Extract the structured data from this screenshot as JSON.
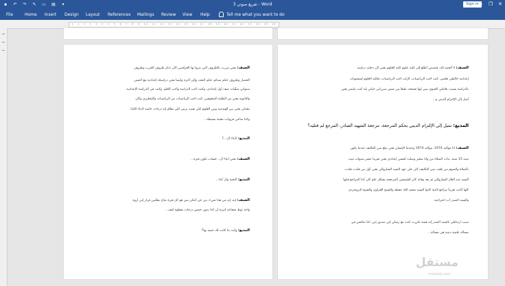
{
  "app": {
    "title": "تفريغ صوتي 3 - Word",
    "signin_label": "Sign in",
    "window_buttons": [
      "—",
      "❐",
      "✕"
    ]
  },
  "ribbon": {
    "tabs": [
      "File",
      "Home",
      "Insert",
      "Design",
      "Layout",
      "References",
      "Mailings",
      "Review",
      "View",
      "Help"
    ],
    "tell_me": "Tell me what you want to do"
  },
  "ruler": {
    "ticks": "· 2 · 1 · ▾ · 1 · 2 · 3 · 4 · 5 · 6 · 7 · 8 · 9 · 10 · 11 · 12 · 13 · 14 · 15 · 16 · 17 · 18 · 19 · 20 · 21 · 22 · 23 · 24 · 25 · 26 · 27 · 28 · 29 · 30 · 31"
  },
  "left_page": {
    "lines": [
      {
        "label": "الضيف:",
        "text": " يعني مررت بالظروف التي مروا بها العراقيين الأن تذكر ظروف الحرب وظروف"
      },
      {
        "label": "",
        "text": "الحصار وظروف حكم صدام، حكم البعث وإلى آخره وأيضاً يعني دراستك إعدادية مع أحسن"
      },
      {
        "label": "",
        "text": "سنواتي صفّيات صف أول إعدادي، وكنت أحب الدراسة وأحب العلم، وكنت في الدراسة الإعدادية"
      },
      {
        "label": "",
        "text": "والثانوية يعني من الطلبة المتفوقين، كنت أحب الرياضيات من الرياضيات والإنجليزي وكان"
      },
      {
        "label": "",
        "text": "معدلي يعني بين الهندسة وبين العلوم لكن بقيت بزمن لكن نظام إنه درجات خاصة لأبناء الكذا"
      },
      {
        "label": "",
        "text": "وكذا ساعي فرويات معينة بسيطة..."
      },
      {
        "label": "المذيع:",
        "text": " لأبناء ال...؟"
      },
      {
        "label": "الضيف:",
        "text": " يعني أبناء ال...حساب تكون فترة..."
      },
      {
        "label": "المذيع:",
        "text": " النخبة وال كذا..."
      },
      {
        "label": "الضيف:",
        "text": " إيه، إيه من هذا شيء، من جي أنتكن بس هو كل فترة متاح بطلبين قرار إني أروه"
      },
      {
        "label": "",
        "text": "واخذ توط شجاعة كبيرة أن كذا بدون خمس درجات يعطوه كيف..."
      },
      {
        "label": "المذيع:",
        "text": " وأنت ما كانت لك حصة بها؟"
      }
    ]
  },
  "right_page": {
    "lines": [
      {
        "label": "الضيف:",
        "text": " لا الحمد لله، فتمنيتي أطلع إلى كلية علوم كلية العلوم يعني لأن دخلت دراسة"
      },
      {
        "label": "",
        "text": "إعدادية خالطي تعلمي، كنت أحب الرياضيات، لأزلت أحب الرياضيات، فكلية العلوم لمستويات"
      },
      {
        "label": "",
        "text": "بالدراسة بسبب تعاملي الحيوي بيني إنها فسحة، طبعاً من ضمن مبرراتي حياتي إنه كنت مليس يعني"
      },
      {
        "label": "",
        "text": "أميل إلى الإلتزام الديني و..."
      },
      {
        "label": "المذيع:",
        "text": " تميل إلى الإلتزام الديني بحكم المرجعة، مرجعة الشهيد الصادر، المرجع لم قتليه؟"
      },
      {
        "label": "الضيف:",
        "text": " أنا مواليد 1974، مواليد 1974 وعندما الإنسان يعني يبلغ سن التكليف عندما يكون"
      },
      {
        "label": "",
        "text": "سنه 15 سنة، بدأت الصلاة من وأنا صغير وصلت لحسن إعدادي يعني تقريباً عشر سنوات نبيت"
      },
      {
        "label": "",
        "text": "بالصلاة والصوم من بلغت سن التكليف كان على عهد السيد السازوالي يعني أول من قلدت قلدت"
      },
      {
        "label": "",
        "text": "السيد عبد العال السازوالي ثم بعد وفاته كان الشمسي المرجعية بشكل عام كان كذا المراجع قبلها"
      },
      {
        "label": "",
        "text": "كلها كانت تقريباً مراجع لاثنتة كانوا السيد محمد الله حفظه والشيخ الغراوي والشيخ البروجردي"
      },
      {
        "label": "",
        "text": "والسيد الصدر أب اعتراعيه."
      },
      {
        "label": "",
        "text": "سبب ارتباطي بالسيد الصدر إنه قصة تكررت كنت مع زميلي إني صديق إني، كنا نتناقش في"
      },
      {
        "label": "",
        "text": "مسألة علمية دينية هي مسالة..."
      }
    ]
  },
  "watermark": {
    "text": "مستقل",
    "sub": "mostaql.com"
  }
}
